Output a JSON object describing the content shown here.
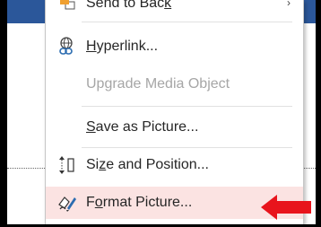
{
  "menu": {
    "items": [
      {
        "label_pre": "Send to Bac",
        "label_ul": "k",
        "label_post": "",
        "icon": "send-to-back-icon"
      },
      {
        "label_pre": "",
        "label_ul": "H",
        "label_post": "yperlink...",
        "icon": "hyperlink-icon"
      },
      {
        "label_pre": "Upgrade Media Object",
        "label_ul": "",
        "label_post": "",
        "icon": "",
        "disabled": true
      },
      {
        "label_pre": "",
        "label_ul": "S",
        "label_post": "ave as Picture...",
        "icon": ""
      },
      {
        "label_pre": "Si",
        "label_ul": "z",
        "label_post": "e and Position...",
        "icon": "size-position-icon"
      },
      {
        "label_pre": "F",
        "label_ul": "o",
        "label_post": "rmat Picture...",
        "icon": "format-picture-icon",
        "highlighted": true
      }
    ]
  },
  "annotation": {
    "arrow_color": "#e8141c",
    "highlight_color": "#fbe3e2"
  },
  "theme": {
    "ribbon_color": "#2b579a"
  }
}
